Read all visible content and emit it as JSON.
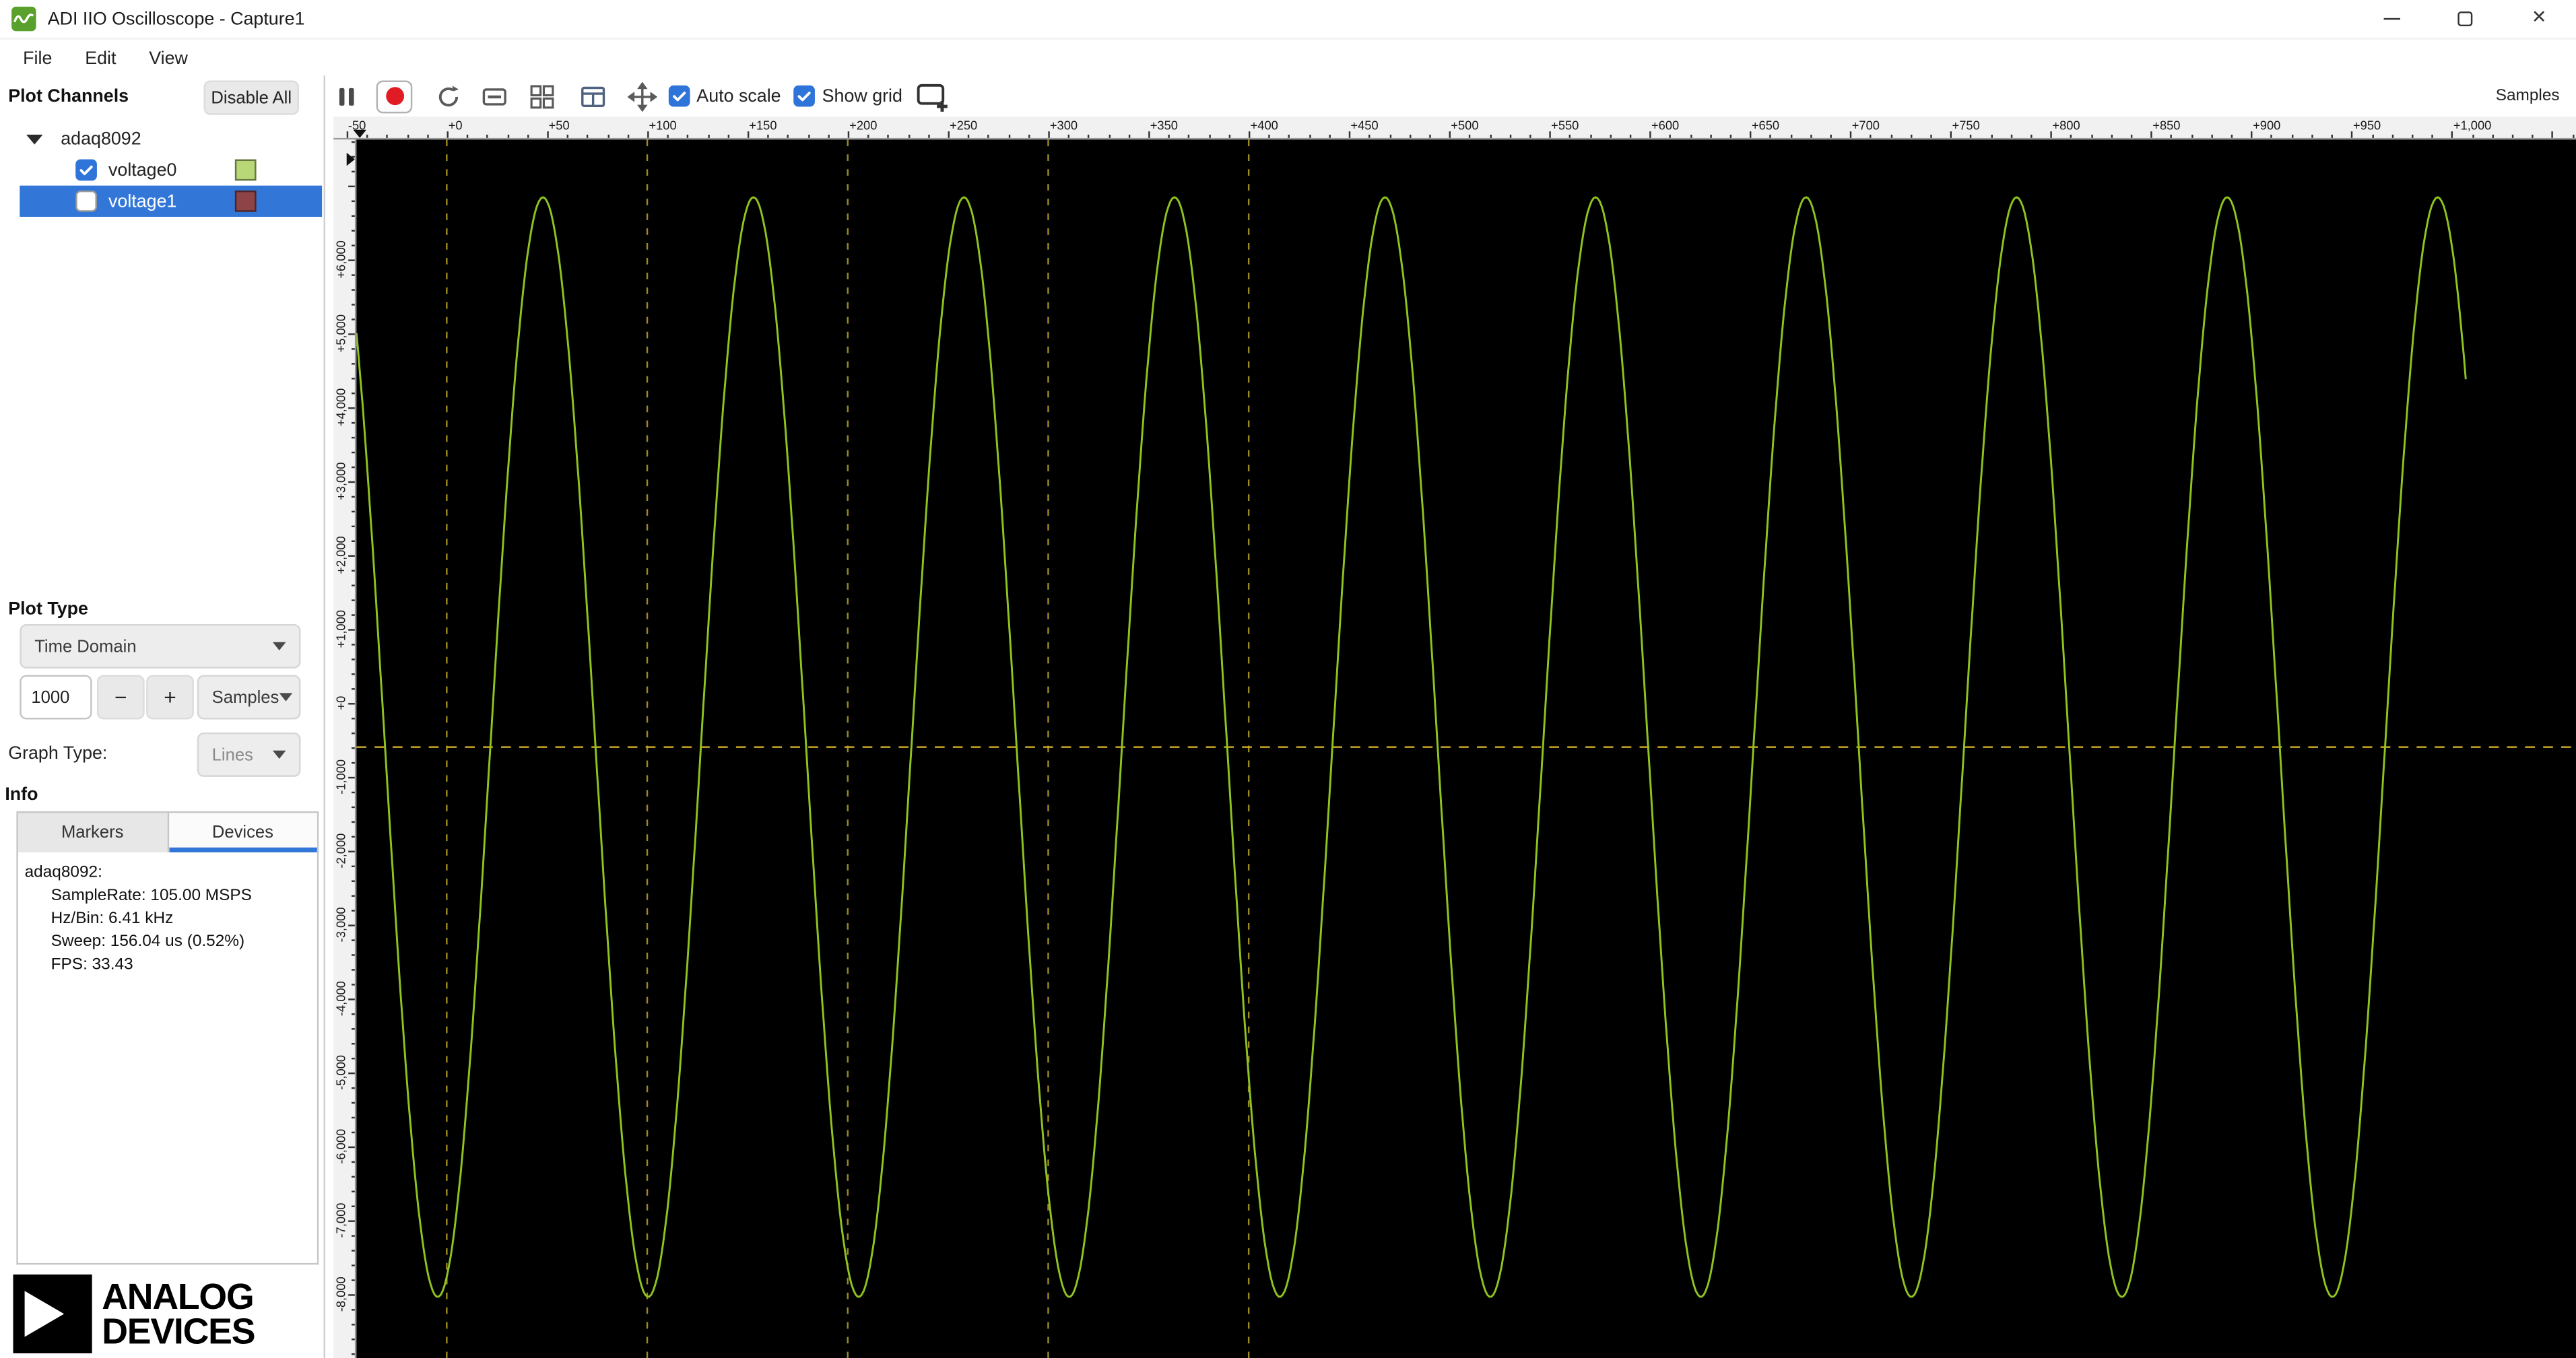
{
  "window": {
    "title": "ADI IIO Oscilloscope - Capture1"
  },
  "menu": {
    "items": [
      "File",
      "Edit",
      "View"
    ]
  },
  "sidebar": {
    "plot_channels": {
      "label": "Plot Channels",
      "disable_all_label": "Disable All",
      "device": {
        "name": "adaq8092",
        "expanded": true,
        "channels": [
          {
            "name": "voltage0",
            "checked": true,
            "color": "#b8d878",
            "selected": false
          },
          {
            "name": "voltage1",
            "checked": false,
            "color": "#8e4446",
            "selected": true
          }
        ]
      }
    },
    "plot_type": {
      "label": "Plot Type",
      "value": "Time Domain"
    },
    "sample_count": {
      "value": "1000",
      "minus_label": "−",
      "plus_label": "+",
      "unit": "Samples"
    },
    "graph_type": {
      "label": "Graph Type:",
      "value": "Lines"
    },
    "info": {
      "label": "Info",
      "tabs": [
        {
          "label": "Markers",
          "active": false
        },
        {
          "label": "Devices",
          "active": true
        }
      ],
      "device_title": "adaq8092:",
      "lines": [
        "SampleRate: 105.00 MSPS",
        "Hz/Bin: 6.41 kHz",
        "Sweep: 156.04 us (0.52%)",
        "FPS: 33.43"
      ]
    },
    "logo": {
      "line1": "ANALOG",
      "line2": "DEVICES"
    }
  },
  "toolbar": {
    "icons": [
      "capture-pause-icon",
      "record-button",
      "single-capture-icon",
      "zero-line-icon",
      "grid-view-icon",
      "plot-window-icon",
      "pan-icon",
      "add-plot-icon"
    ],
    "auto_scale_label": "Auto scale",
    "auto_scale_checked": true,
    "show_grid_label": "Show grid",
    "show_grid_checked": true,
    "samples_label": "Samples"
  },
  "chart_data": {
    "type": "line",
    "background": "#000000",
    "x_axis": {
      "label": "Samples",
      "min": -45,
      "max": 1062,
      "tick_values": [
        -50,
        0,
        50,
        100,
        150,
        200,
        250,
        300,
        350,
        400,
        450,
        500,
        550,
        600,
        650,
        700,
        750,
        800,
        850,
        900,
        950,
        1000
      ],
      "tick_labels": [
        "-50",
        "+0",
        "+50",
        "+100",
        "+150",
        "+200",
        "+250",
        "+300",
        "+350",
        "+400",
        "+450",
        "+500",
        "+550",
        "+600",
        "+650",
        "+700",
        "+750",
        "+800",
        "+850",
        "+900",
        "+950",
        "+1,000"
      ]
    },
    "y_axis": {
      "min": -8870,
      "max": 7620,
      "tick_values": [
        6000,
        5000,
        4000,
        3000,
        2000,
        1000,
        0,
        -1000,
        -2000,
        -3000,
        -4000,
        -5000,
        -6000,
        -7000,
        -8000
      ],
      "tick_labels": [
        "+6,000",
        "+5,000",
        "+4,000",
        "+3,000",
        "+2,000",
        "+1,000",
        "+0",
        "-1,000",
        "-2,000",
        "-3,000",
        "-4,000",
        "-5,000",
        "-6,000",
        "-7,000",
        "-8,000"
      ]
    },
    "grid": {
      "show": true,
      "vertical_line_samples": [
        0,
        100,
        200,
        300,
        400
      ],
      "color": "#9a8a20",
      "average_line_value": -600,
      "average_line_color": "#c8a428"
    },
    "series": [
      {
        "name": "voltage0",
        "color": "#8fc31f",
        "shape": "sine",
        "amplitude": 7440,
        "offset": -600,
        "period_samples": 105,
        "peak_at_sample": 48,
        "start_sample": -45,
        "end_sample": 1007
      }
    ]
  }
}
